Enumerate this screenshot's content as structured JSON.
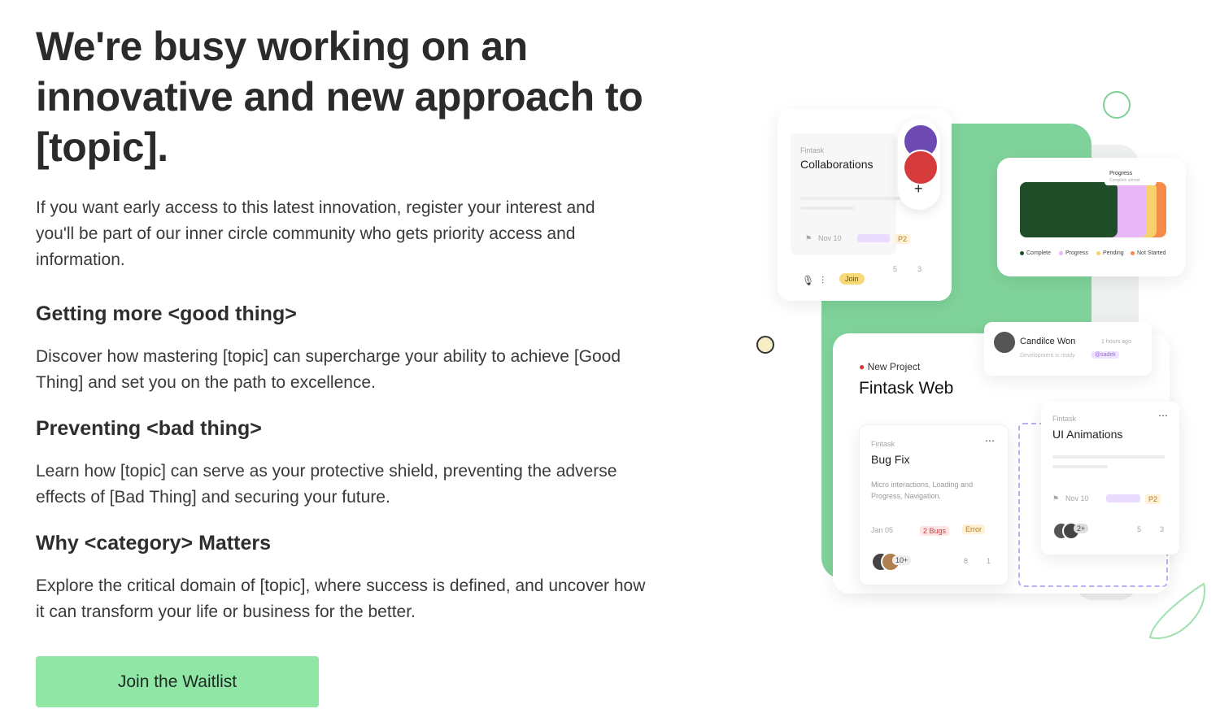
{
  "hero": {
    "title": "We're busy working on an innovative and new approach to [topic].",
    "intro": "If you want early access to this latest innovation, register your interest and you'll be part of our inner circle community who gets priority access and information."
  },
  "features": [
    {
      "heading": "Getting more <good thing>",
      "body": "Discover how mastering [topic] can supercharge your ability to achieve [Good Thing] and set you on the path to excellence."
    },
    {
      "heading": "Preventing <bad thing>",
      "body": "Learn how [topic] can serve as your protective shield, preventing the adverse effects of [Bad Thing] and securing your future."
    },
    {
      "heading": "Why <category> Matters",
      "body": "Explore the critical domain of [topic], where success is defined, and uncover how it can transform your life or business for the better."
    }
  ],
  "cta": {
    "label": "Join the Waitlist"
  },
  "illustration": {
    "collab_card": {
      "brand": "Fintask",
      "title": "Collaborations",
      "date": "Nov 10",
      "priority": "P2",
      "join": "Join",
      "comments": "5",
      "attachments": "3"
    },
    "progress_card": {
      "title": "Progress",
      "subtitle": "Complete almost",
      "legend": [
        "Complete",
        "Progress",
        "Pending",
        "Not Started"
      ]
    },
    "notify_card": {
      "name": "Candilce Won",
      "time": "1 hours ago",
      "message": "Development is ready",
      "mention": "@sadek"
    },
    "project_card": {
      "label": "New Project",
      "title": "Fintask Web"
    },
    "bugfix_card": {
      "brand": "Fintask",
      "title": "Bug Fix",
      "desc": "Micro interactions, Loading and Progress, Navigation.",
      "date": "Jan 05",
      "bugs": "2 Bugs",
      "error": "Error",
      "more": "10+",
      "comments": "8",
      "attachments": "1"
    },
    "anim_card": {
      "brand": "Fintask",
      "title": "UI Animations",
      "date": "Nov 10",
      "priority": "P2",
      "more": "2+",
      "comments": "5",
      "attachments": "3"
    }
  },
  "colors": {
    "accent": "#8fe6a5",
    "illustration_green": "#7fd39a",
    "text": "#2b2b2b"
  }
}
